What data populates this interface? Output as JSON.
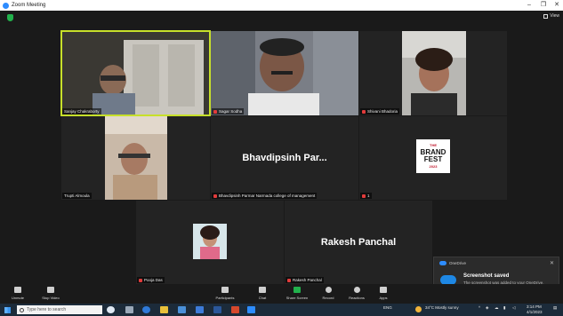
{
  "window": {
    "title": "Zoom Meeting",
    "controls": [
      "–",
      "❐",
      "✕"
    ]
  },
  "view_button": {
    "label": "View"
  },
  "participants_tiles": [
    {
      "name": "Sanjay Chakraborty",
      "muted": false,
      "has_video": true,
      "active_speaker": true
    },
    {
      "name": "Sagar Sodha",
      "muted": true,
      "has_video": true
    },
    {
      "name": "Shivani Bhadoria",
      "muted": true,
      "has_video": true
    },
    {
      "name": "Trupti Almoula",
      "muted": false,
      "has_video": true
    },
    {
      "name": "Bhavdipsinh Parmar Narmada college of management",
      "display_name": "Bhavdipsinh Par...",
      "muted": true,
      "has_video": false
    },
    {
      "name": "1",
      "muted": true,
      "has_video": true,
      "logo_text": [
        "THE",
        "BRAND",
        "FEST",
        "2023"
      ]
    },
    {
      "name": "Pooja Das",
      "muted": true,
      "has_video": true
    },
    {
      "name": "Rakesh Panchal",
      "display_name": "Rakesh Panchal",
      "muted": true,
      "has_video": false
    }
  ],
  "notification": {
    "app": "OneDrive",
    "title": "Screenshot saved",
    "body": "The screenshot was added to your OneDrive."
  },
  "toolbar": {
    "unmute": "Unmute",
    "stop_video": "Stop Video",
    "participants": "Participants",
    "participants_count": "9",
    "chat": "Chat",
    "share_screen": "Share Screen",
    "record": "Record",
    "reactions": "Reactions",
    "apps": "Apps"
  },
  "taskbar": {
    "search_placeholder": "Type here to search",
    "weather": "34°C  Mostly sunny",
    "lang": "ENG",
    "time": "3:14 PM",
    "date": "4/1/2023"
  },
  "colors": {
    "active_outline": "#c7e02a",
    "share_green": "#22b14c",
    "zoom_blue": "#2d8cff"
  }
}
